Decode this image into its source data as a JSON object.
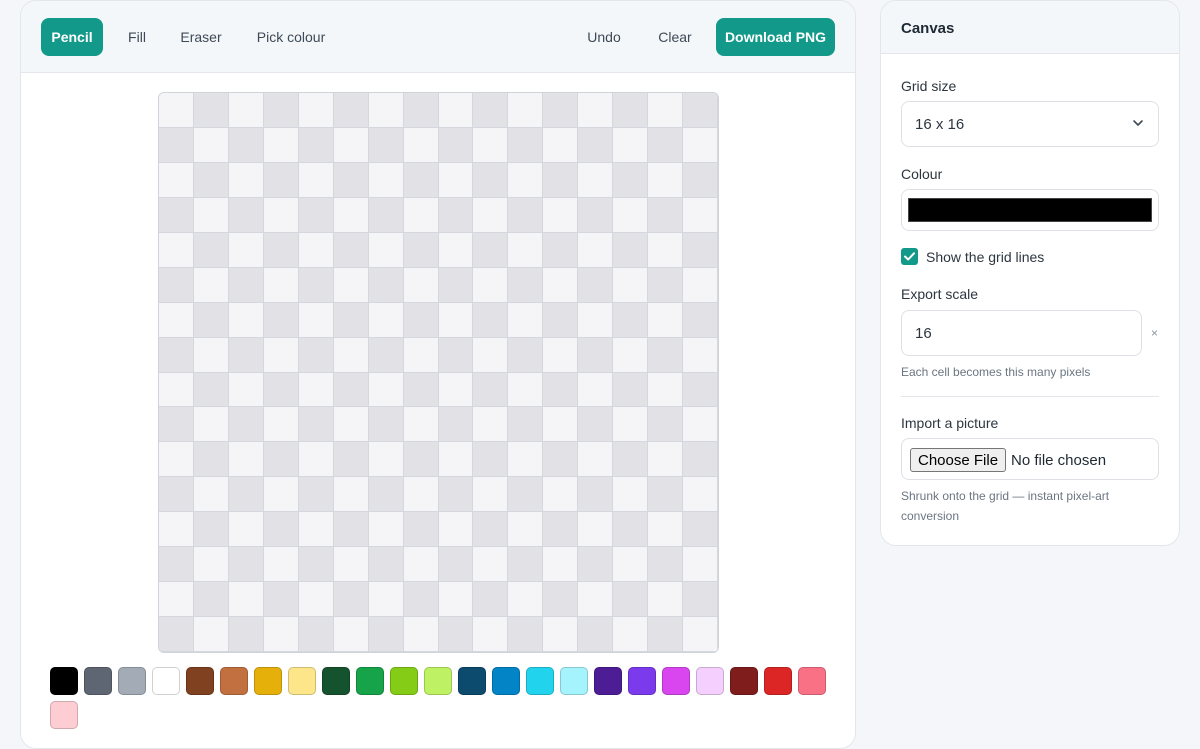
{
  "toolbar": {
    "tools": [
      {
        "label": "Pencil",
        "active": true
      },
      {
        "label": "Fill",
        "active": false
      },
      {
        "label": "Eraser",
        "active": false
      },
      {
        "label": "Pick colour",
        "active": false
      }
    ],
    "undo_label": "Undo",
    "clear_label": "Clear",
    "download_label": "Download PNG"
  },
  "grid": {
    "rows": 16,
    "cols": 16
  },
  "palette": [
    "#000000",
    "#5e6673",
    "#a3abb6",
    "#ffffff",
    "#7f4120",
    "#c27040",
    "#e6b00a",
    "#fde68a",
    "#14532d",
    "#16a34a",
    "#84cc16",
    "#bef264",
    "#0c4a6e",
    "#0284c7",
    "#22d3ee",
    "#a5f3fc",
    "#4c1d95",
    "#7c3aed",
    "#d946ef",
    "#f5d0fe",
    "#7f1d1d",
    "#dc2626",
    "#f87185",
    "#fecdd3"
  ],
  "sidebar": {
    "title": "Canvas",
    "grid_size_label": "Grid size",
    "grid_size_value": "16 x 16",
    "colour_label": "Colour",
    "colour_value": "#000000",
    "show_grid_label": "Show the grid lines",
    "show_grid_checked": true,
    "export_scale_label": "Export scale",
    "export_scale_value": "16",
    "export_scale_unit": "×",
    "export_scale_hint": "Each cell becomes this many pixels",
    "import_label": "Import a picture",
    "import_button": "Choose File",
    "import_status": "No file chosen",
    "import_hint": "Shrunk onto the grid — instant pixel-art conversion"
  },
  "colors": {
    "accent": "#13998a",
    "cell_light": "#f5f5f7",
    "cell_dark": "#e2e2e6"
  }
}
